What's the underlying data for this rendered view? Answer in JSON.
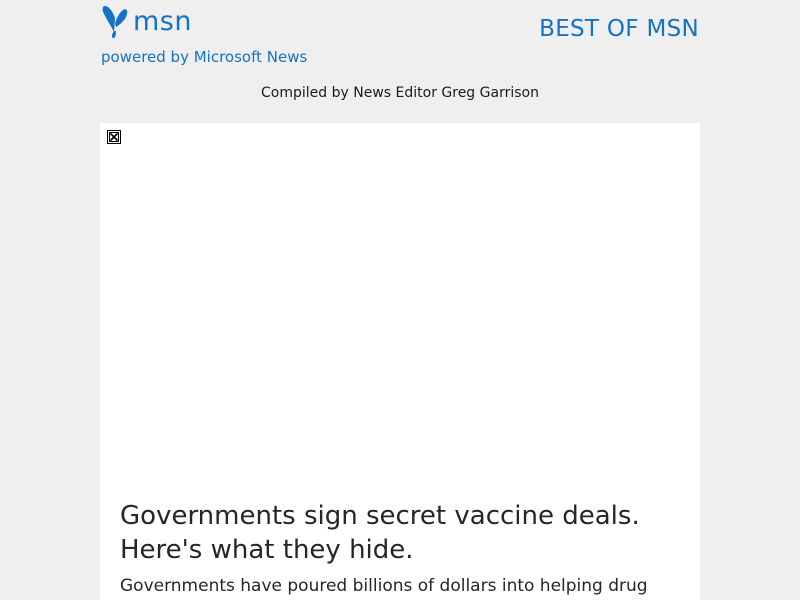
{
  "header": {
    "logo_text": "msn",
    "logo_icon": "butterfly-icon",
    "powered_by": "powered by Microsoft News",
    "section_title": "BEST OF MSN",
    "compiled_by": "Compiled by News Editor Greg Garrison"
  },
  "article": {
    "image_icon": "broken-image-icon",
    "headline": "Governments sign secret vaccine deals. Here's what they hide.",
    "summary": "Governments have poured billions of dollars into helping drug"
  },
  "colors": {
    "brand_blue": "#1572c6",
    "page_background": "#efefef",
    "card_background": "#ffffff",
    "text": "#262626"
  }
}
